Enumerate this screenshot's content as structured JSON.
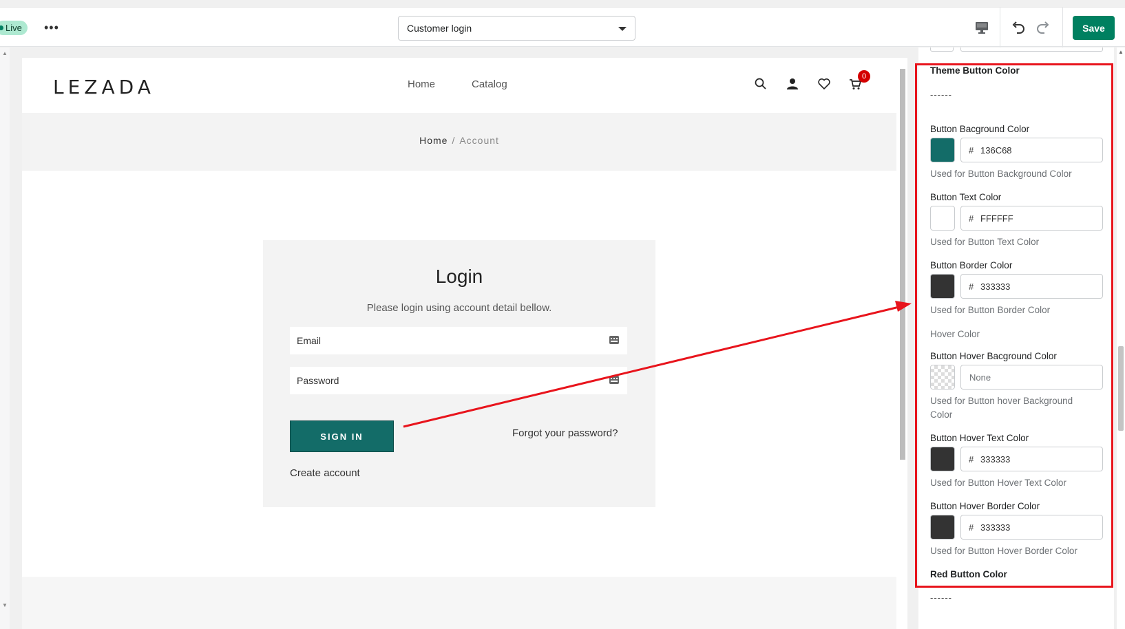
{
  "topbar": {
    "live_badge": "Live",
    "more_label": "•••",
    "template_select": {
      "value": "Customer login"
    },
    "save_label": "Save"
  },
  "store": {
    "logo": "LEZADA",
    "nav": [
      "Home",
      "Catalog"
    ],
    "cart_count": "0",
    "breadcrumb": {
      "home": "Home",
      "separator": "/",
      "current": "Account"
    }
  },
  "login": {
    "title": "Login",
    "subtitle": "Please login using account detail bellow.",
    "email_placeholder": "Email",
    "password_placeholder": "Password",
    "signin_label": "SIGN IN",
    "forgot_label": "Forgot your password?",
    "create_label": "Create account"
  },
  "panel": {
    "theme_heading": "Theme Button Color",
    "theme_divider": "------",
    "fields": [
      {
        "label": "Button Bacground Color",
        "hash": "#",
        "value": "136C68",
        "color": "#136C68",
        "help": "Used for Button Background Color"
      },
      {
        "label": "Button Text Color",
        "hash": "#",
        "value": "FFFFFF",
        "color": "#FFFFFF",
        "help": "Used for Button Text Color"
      },
      {
        "label": "Button Border Color",
        "hash": "#",
        "value": "333333",
        "color": "#333333",
        "help": "Used for Button Border Color"
      }
    ],
    "hover_heading": "Hover Color",
    "hover_fields": [
      {
        "label": "Button Hover Bacground Color",
        "value": "None",
        "help": "Used for Button hover Background Color"
      },
      {
        "label": "Button Hover Text Color",
        "hash": "#",
        "value": "333333",
        "color": "#333333",
        "help": "Used for Button Hover Text Color"
      },
      {
        "label": "Button Hover Border Color",
        "hash": "#",
        "value": "333333",
        "color": "#333333",
        "help": "Used for Button Hover Border Color"
      }
    ],
    "red_heading": "Red Button Color",
    "red_divider": "------"
  },
  "colors": {
    "save_green": "#008060",
    "annotation_red": "#e8141c",
    "button_teal": "#136c68"
  }
}
